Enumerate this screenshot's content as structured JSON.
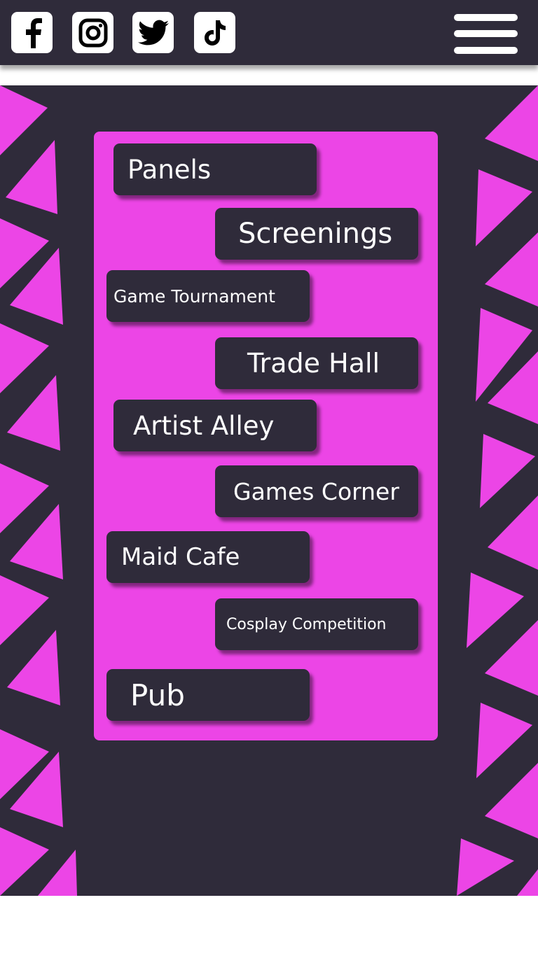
{
  "social_links": [
    {
      "name": "facebook",
      "icon": "facebook-icon"
    },
    {
      "name": "instagram",
      "icon": "instagram-icon"
    },
    {
      "name": "twitter",
      "icon": "twitter-icon"
    },
    {
      "name": "tiktok",
      "icon": "tiktok-icon"
    }
  ],
  "menu": {
    "icon": "hamburger-menu-icon"
  },
  "colors": {
    "dark": "#2f2b3a",
    "accent": "#ec45e6",
    "text": "#ffffff"
  },
  "nav": {
    "panels": "Panels",
    "screenings": "Screenings",
    "game_tournament": "Game Tournament",
    "trade_hall": "Trade Hall",
    "artist_alley": "Artist Alley",
    "games_corner": "Games Corner",
    "maid_cafe": "Maid Cafe",
    "cosplay_competition": "Cosplay Competition",
    "pub": "Pub"
  }
}
